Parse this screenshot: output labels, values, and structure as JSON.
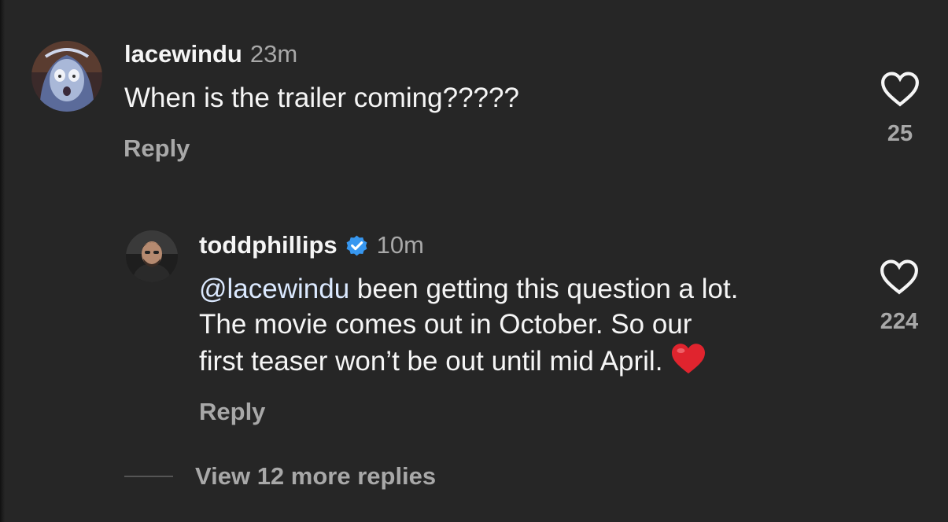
{
  "comments": [
    {
      "username": "lacewindu",
      "time": "23m",
      "text": "When is the trailer coming?????",
      "reply_label": "Reply",
      "likes": "25",
      "avatar_icon": "zombie-bride-avatar"
    }
  ],
  "reply": {
    "username": "toddphillips",
    "verified": true,
    "time": "10m",
    "mention": "@lacewindu",
    "text_line1": " been getting this question a lot.",
    "text_line2": "The movie comes out in October. So our",
    "text_line3": "first teaser won’t be out until mid April.",
    "reply_label": "Reply",
    "likes": "224",
    "avatar_icon": "man-portrait-avatar"
  },
  "view_more": {
    "label": "View 12 more replies"
  },
  "colors": {
    "background": "#262626",
    "primary_text": "#f5f5f5",
    "secondary_text": "#a8a8a8",
    "verified_blue": "#3797f0",
    "heart_red": "#e0242e"
  }
}
